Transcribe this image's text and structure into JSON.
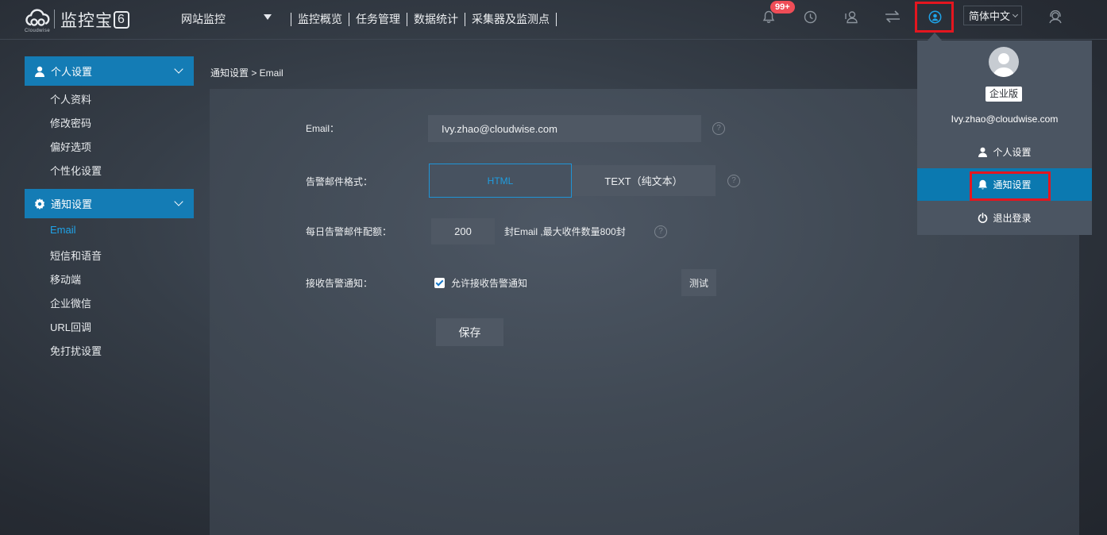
{
  "header": {
    "logo_text": "监控宝",
    "logo_digit": "6",
    "logo_sub": "Cloudwise",
    "product_menu": "网站监控",
    "nav": [
      "监控概览",
      "任务管理",
      "数据统计",
      "采集器及监测点"
    ],
    "notification_badge": "99+",
    "language": "简体中文"
  },
  "sidebar": {
    "groups": [
      {
        "label": "个人设置",
        "icon": "user-icon",
        "items": [
          "个人资料",
          "修改密码",
          "偏好选项",
          "个性化设置"
        ]
      },
      {
        "label": "通知设置",
        "icon": "gear-icon",
        "items": [
          "Email",
          "短信和语音",
          "移动端",
          "企业微信",
          "URL回调",
          "免打扰设置"
        ]
      }
    ],
    "active_item": "Email"
  },
  "breadcrumb": "通知设置 > Email",
  "form": {
    "email_label": "Email：",
    "email_value": "Ivy.zhao@cloudwise.com",
    "format_label": "告警邮件格式：",
    "format_options": [
      "HTML",
      "TEXT（纯文本）"
    ],
    "format_selected": "HTML",
    "quota_label": "每日告警邮件配额：",
    "quota_value": "200",
    "quota_note": "封Email ,最大收件数量800封",
    "receive_label": "接收告警通知：",
    "receive_checkbox_label": "允许接收告警通知",
    "receive_checked": true,
    "test_button": "测试",
    "save_button": "保存"
  },
  "user_menu": {
    "edition": "企业版",
    "email": "Ivy.zhao@cloudwise.com",
    "items": [
      {
        "label": "个人设置",
        "icon": "user-icon"
      },
      {
        "label": "通知设置",
        "icon": "bell-icon",
        "active": true
      },
      {
        "label": "退出登录",
        "icon": "power-icon"
      }
    ]
  },
  "colors": {
    "accent": "#147cb5",
    "active_link": "#1fa3e8",
    "highlight_box": "#e4161f",
    "badge": "#ef4d57"
  }
}
